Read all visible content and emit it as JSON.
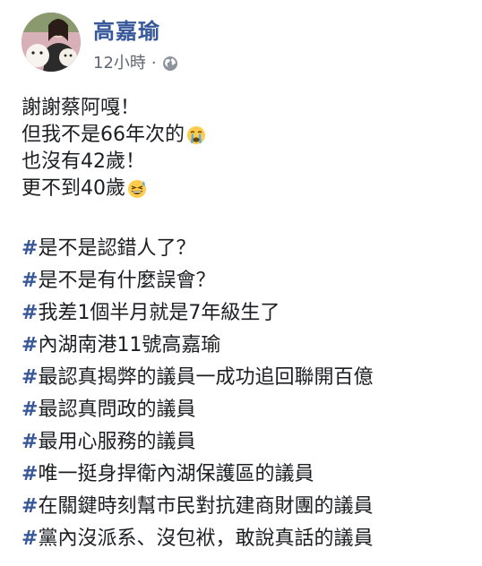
{
  "post": {
    "author": "高嘉瑜",
    "timestamp": "12小時",
    "separator": "·",
    "privacy_icon": "globe-icon",
    "lines": [
      {
        "text": "謝謝蔡阿嘎！",
        "emoji": ""
      },
      {
        "text": "但我不是66年次的",
        "emoji": "crying-face-emoji"
      },
      {
        "text": "也沒有42歲！",
        "emoji": ""
      },
      {
        "text": "更不到40歲",
        "emoji": "grinning-sweat-emoji"
      }
    ],
    "hashtags": [
      "是不是認錯人了？",
      "是不是有什麼誤會？",
      "我差1個半月就是7年級生了",
      "內湖南港11號高嘉瑜",
      "最認真揭弊的議員一成功追回聯開百億",
      "最認真問政的議員",
      "最用心服務的議員",
      "唯一挺身捍衛內湖保護區的議員",
      "在關鍵時刻幫市民對抗建商財團的議員",
      "黨內沒派系、沒包袱，敢說真話的議員"
    ],
    "hash_symbol": "#"
  },
  "colors": {
    "author_link": "#365899",
    "hashtag_symbol": "#385898",
    "text": "#1c1e21",
    "meta": "#616770"
  }
}
